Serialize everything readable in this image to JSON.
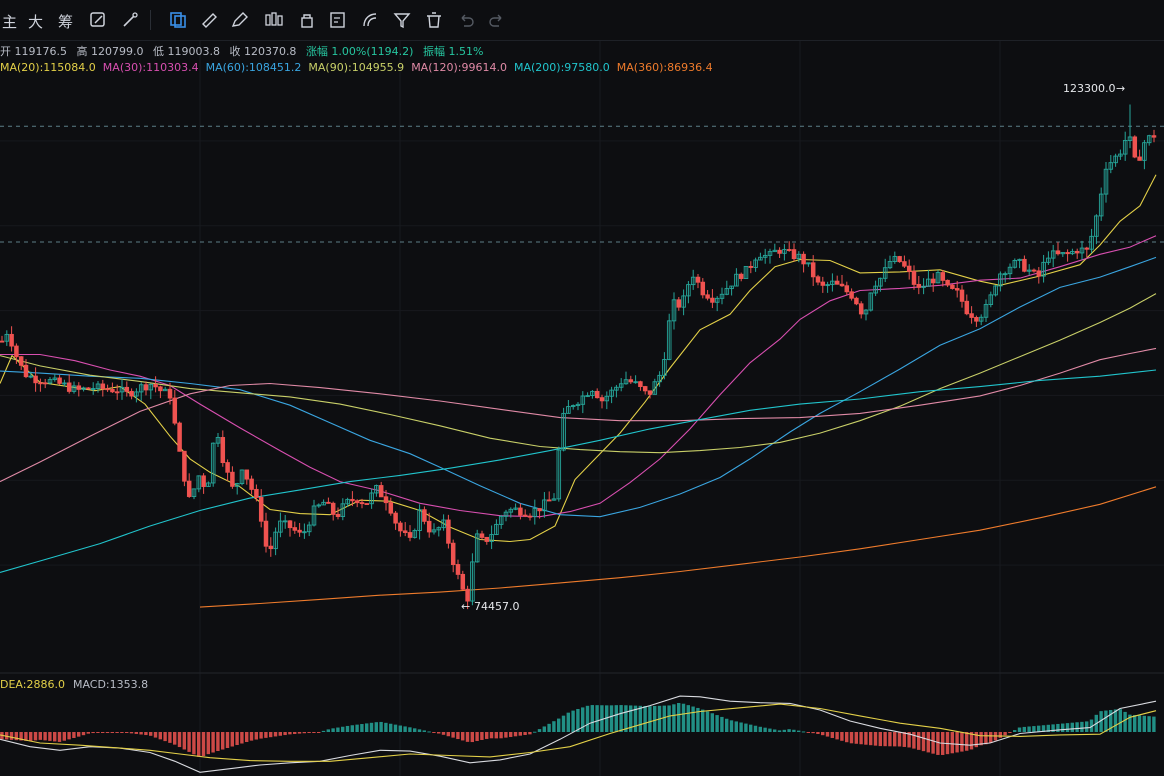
{
  "toolbar": {
    "labels": [
      "主",
      "大",
      "筹"
    ],
    "icons": [
      "edit-icon",
      "magic-brush-icon",
      "selection-icon",
      "ruler-icon",
      "pen-icon",
      "candle-pattern-icon",
      "lock-icon",
      "note-icon",
      "fib-icon",
      "filter-icon",
      "delete-icon",
      "undo-icon",
      "redo-icon"
    ]
  },
  "ohlc": {
    "open": "开 119176.5",
    "high": "高 120799.0",
    "low": "低 119003.8",
    "close": "收 120370.8",
    "change": "涨幅 1.00%(1194.2)",
    "amplitude": "振幅 1.51%"
  },
  "ma_legend": [
    {
      "text": "MA(20):115084.0",
      "color": "#e3d048"
    },
    {
      "text": "MA(30):110303.4",
      "color": "#d84fb0"
    },
    {
      "text": "MA(60):108451.2",
      "color": "#3aa5e0"
    },
    {
      "text": "MA(90):104955.9",
      "color": "#c8cf68"
    },
    {
      "text": "MA(120):99614.0",
      "color": "#e08aa6"
    },
    {
      "text": "MA(200):97580.0",
      "color": "#21c4cc"
    },
    {
      "text": "MA(360):86936.4",
      "color": "#ee7b2c"
    }
  ],
  "macd_legend": [
    {
      "text": "DEA:2886.0",
      "color": "#e3d048"
    },
    {
      "text": "MACD:1353.8",
      "color": "#b8bcc6"
    }
  ],
  "colors": {
    "up": "#26a69a",
    "down": "#ef5350",
    "bull_hist": "#26a69a",
    "bear_hist": "#ef5350",
    "dif": "#d9dbe0",
    "dea": "#e3d048"
  },
  "chart_data": {
    "type": "candlestick",
    "high_label": "123300.0",
    "low_label": "74457.0",
    "y_range": [
      70500,
      128000
    ],
    "ref_lines": [
      121200,
      110000
    ],
    "candles": [],
    "ma_series": [
      {
        "key": "MA(20)",
        "color": "#e3d048",
        "points": [
          [
            0,
            96300
          ],
          [
            12,
            99000
          ],
          [
            40,
            96400
          ],
          [
            75,
            95900
          ],
          [
            95,
            95600
          ],
          [
            120,
            96000
          ],
          [
            145,
            94300
          ],
          [
            170,
            91200
          ],
          [
            190,
            89000
          ],
          [
            210,
            87700
          ],
          [
            240,
            86300
          ],
          [
            270,
            84100
          ],
          [
            300,
            83700
          ],
          [
            330,
            83600
          ],
          [
            360,
            85000
          ],
          [
            390,
            84900
          ],
          [
            420,
            84000
          ],
          [
            450,
            82400
          ],
          [
            480,
            81200
          ],
          [
            510,
            81000
          ],
          [
            530,
            81200
          ],
          [
            555,
            82500
          ],
          [
            575,
            87000
          ],
          [
            600,
            89500
          ],
          [
            620,
            91500
          ],
          [
            645,
            94500
          ],
          [
            670,
            97800
          ],
          [
            700,
            101500
          ],
          [
            730,
            103000
          ],
          [
            750,
            105300
          ],
          [
            775,
            107600
          ],
          [
            800,
            108300
          ],
          [
            830,
            108200
          ],
          [
            860,
            107000
          ],
          [
            900,
            107100
          ],
          [
            940,
            107300
          ],
          [
            980,
            106200
          ],
          [
            1000,
            105800
          ],
          [
            1040,
            106700
          ],
          [
            1080,
            107800
          ],
          [
            1100,
            109700
          ],
          [
            1120,
            112000
          ],
          [
            1140,
            113500
          ],
          [
            1156,
            116500
          ]
        ]
      },
      {
        "key": "MA(30)",
        "color": "#d84fb0",
        "points": [
          [
            0,
            99100
          ],
          [
            40,
            99100
          ],
          [
            75,
            98500
          ],
          [
            110,
            97600
          ],
          [
            140,
            97000
          ],
          [
            170,
            96100
          ],
          [
            200,
            94300
          ],
          [
            240,
            92000
          ],
          [
            280,
            89800
          ],
          [
            310,
            88200
          ],
          [
            340,
            86800
          ],
          [
            380,
            85900
          ],
          [
            420,
            84700
          ],
          [
            460,
            84000
          ],
          [
            500,
            83500
          ],
          [
            540,
            83400
          ],
          [
            570,
            83900
          ],
          [
            600,
            84700
          ],
          [
            630,
            86700
          ],
          [
            660,
            89000
          ],
          [
            690,
            91900
          ],
          [
            720,
            95200
          ],
          [
            750,
            98300
          ],
          [
            780,
            100600
          ],
          [
            800,
            102500
          ],
          [
            830,
            104300
          ],
          [
            860,
            105300
          ],
          [
            900,
            105500
          ],
          [
            940,
            105800
          ],
          [
            980,
            106300
          ],
          [
            1020,
            106500
          ],
          [
            1060,
            107600
          ],
          [
            1100,
            108800
          ],
          [
            1130,
            109500
          ],
          [
            1156,
            110600
          ]
        ]
      },
      {
        "key": "MA(60)",
        "color": "#3aa5e0",
        "points": [
          [
            0,
            97500
          ],
          [
            40,
            97300
          ],
          [
            90,
            97000
          ],
          [
            140,
            96800
          ],
          [
            190,
            96300
          ],
          [
            240,
            95700
          ],
          [
            290,
            94200
          ],
          [
            330,
            92500
          ],
          [
            370,
            90800
          ],
          [
            410,
            89500
          ],
          [
            440,
            88200
          ],
          [
            480,
            86400
          ],
          [
            520,
            84700
          ],
          [
            560,
            83600
          ],
          [
            600,
            83400
          ],
          [
            640,
            84300
          ],
          [
            680,
            85600
          ],
          [
            720,
            87200
          ],
          [
            750,
            89000
          ],
          [
            790,
            91600
          ],
          [
            820,
            93400
          ],
          [
            860,
            95500
          ],
          [
            900,
            97700
          ],
          [
            940,
            100000
          ],
          [
            980,
            101600
          ],
          [
            1020,
            103700
          ],
          [
            1060,
            105600
          ],
          [
            1100,
            106600
          ],
          [
            1130,
            107600
          ],
          [
            1156,
            108500
          ]
        ]
      },
      {
        "key": "MA(90)",
        "color": "#c8cf68",
        "points": [
          [
            0,
            99000
          ],
          [
            40,
            98000
          ],
          [
            90,
            97100
          ],
          [
            140,
            96500
          ],
          [
            190,
            95800
          ],
          [
            240,
            95400
          ],
          [
            290,
            95000
          ],
          [
            340,
            94300
          ],
          [
            390,
            93300
          ],
          [
            440,
            92200
          ],
          [
            490,
            91000
          ],
          [
            540,
            90200
          ],
          [
            580,
            89900
          ],
          [
            620,
            89700
          ],
          [
            660,
            89600
          ],
          [
            700,
            89800
          ],
          [
            740,
            90100
          ],
          [
            780,
            90600
          ],
          [
            820,
            91500
          ],
          [
            860,
            92700
          ],
          [
            900,
            94100
          ],
          [
            940,
            95800
          ],
          [
            980,
            97300
          ],
          [
            1020,
            98900
          ],
          [
            1060,
            100500
          ],
          [
            1100,
            102200
          ],
          [
            1130,
            103600
          ],
          [
            1156,
            105000
          ]
        ]
      },
      {
        "key": "MA(120)",
        "color": "#e08aa6",
        "points": [
          [
            0,
            86800
          ],
          [
            40,
            88700
          ],
          [
            90,
            91200
          ],
          [
            140,
            93600
          ],
          [
            190,
            95300
          ],
          [
            230,
            96100
          ],
          [
            270,
            96300
          ],
          [
            320,
            95900
          ],
          [
            380,
            95300
          ],
          [
            440,
            94600
          ],
          [
            500,
            93800
          ],
          [
            560,
            93000
          ],
          [
            620,
            92700
          ],
          [
            680,
            92700
          ],
          [
            740,
            92900
          ],
          [
            800,
            93000
          ],
          [
            860,
            93400
          ],
          [
            920,
            94200
          ],
          [
            980,
            95100
          ],
          [
            1020,
            96100
          ],
          [
            1060,
            97300
          ],
          [
            1100,
            98600
          ],
          [
            1130,
            99200
          ],
          [
            1156,
            99700
          ]
        ]
      },
      {
        "key": "MA(200)",
        "color": "#21c4cc",
        "points": [
          [
            0,
            78000
          ],
          [
            50,
            79400
          ],
          [
            100,
            80800
          ],
          [
            150,
            82500
          ],
          [
            200,
            84000
          ],
          [
            250,
            85200
          ],
          [
            300,
            86000
          ],
          [
            350,
            86800
          ],
          [
            400,
            87400
          ],
          [
            450,
            88100
          ],
          [
            500,
            88900
          ],
          [
            550,
            89800
          ],
          [
            600,
            90800
          ],
          [
            650,
            91900
          ],
          [
            700,
            92800
          ],
          [
            750,
            93700
          ],
          [
            800,
            94300
          ],
          [
            860,
            94800
          ],
          [
            920,
            95500
          ],
          [
            980,
            96000
          ],
          [
            1040,
            96600
          ],
          [
            1100,
            97000
          ],
          [
            1156,
            97600
          ]
        ]
      },
      {
        "key": "MA(360)",
        "color": "#ee7b2c",
        "points": [
          [
            200,
            74650
          ],
          [
            260,
            75000
          ],
          [
            320,
            75400
          ],
          [
            380,
            75800
          ],
          [
            440,
            76100
          ],
          [
            500,
            76500
          ],
          [
            560,
            77000
          ],
          [
            620,
            77500
          ],
          [
            680,
            78100
          ],
          [
            740,
            78800
          ],
          [
            800,
            79500
          ],
          [
            860,
            80300
          ],
          [
            920,
            81200
          ],
          [
            980,
            82100
          ],
          [
            1040,
            83300
          ],
          [
            1100,
            84600
          ],
          [
            1156,
            86300
          ]
        ]
      }
    ],
    "macd": {
      "range": [
        -6000,
        6000
      ],
      "dif": [
        [
          0,
          -1000
        ],
        [
          30,
          -2000
        ],
        [
          60,
          -2500
        ],
        [
          90,
          -2000
        ],
        [
          120,
          -2200
        ],
        [
          150,
          -2800
        ],
        [
          175,
          -4000
        ],
        [
          200,
          -5500
        ],
        [
          230,
          -5000
        ],
        [
          260,
          -4500
        ],
        [
          290,
          -4200
        ],
        [
          320,
          -4000
        ],
        [
          350,
          -3200
        ],
        [
          380,
          -2500
        ],
        [
          410,
          -2600
        ],
        [
          440,
          -3300
        ],
        [
          470,
          -4200
        ],
        [
          500,
          -3800
        ],
        [
          530,
          -3000
        ],
        [
          560,
          -1000
        ],
        [
          590,
          1200
        ],
        [
          620,
          2500
        ],
        [
          650,
          3600
        ],
        [
          680,
          4900
        ],
        [
          700,
          4800
        ],
        [
          730,
          4200
        ],
        [
          760,
          4000
        ],
        [
          790,
          3900
        ],
        [
          820,
          3000
        ],
        [
          850,
          1500
        ],
        [
          880,
          500
        ],
        [
          910,
          -300
        ],
        [
          940,
          -1500
        ],
        [
          970,
          -1800
        ],
        [
          990,
          -1500
        ],
        [
          1020,
          -200
        ],
        [
          1060,
          300
        ],
        [
          1090,
          600
        ],
        [
          1120,
          3200
        ],
        [
          1156,
          4200
        ]
      ],
      "dea": [
        [
          0,
          -400
        ],
        [
          40,
          -1500
        ],
        [
          80,
          -1800
        ],
        [
          120,
          -2200
        ],
        [
          150,
          -2500
        ],
        [
          180,
          -3000
        ],
        [
          210,
          -3500
        ],
        [
          250,
          -3900
        ],
        [
          290,
          -4000
        ],
        [
          330,
          -4000
        ],
        [
          370,
          -3500
        ],
        [
          410,
          -3000
        ],
        [
          450,
          -3200
        ],
        [
          490,
          -3400
        ],
        [
          530,
          -2800
        ],
        [
          570,
          -2000
        ],
        [
          610,
          -200
        ],
        [
          640,
          1000
        ],
        [
          670,
          2200
        ],
        [
          700,
          2800
        ],
        [
          740,
          3300
        ],
        [
          780,
          3800
        ],
        [
          820,
          3200
        ],
        [
          860,
          2200
        ],
        [
          900,
          1200
        ],
        [
          940,
          500
        ],
        [
          980,
          -500
        ],
        [
          1020,
          -600
        ],
        [
          1060,
          -400
        ],
        [
          1100,
          -300
        ],
        [
          1130,
          2000
        ],
        [
          1156,
          2900
        ]
      ],
      "hist": []
    }
  }
}
